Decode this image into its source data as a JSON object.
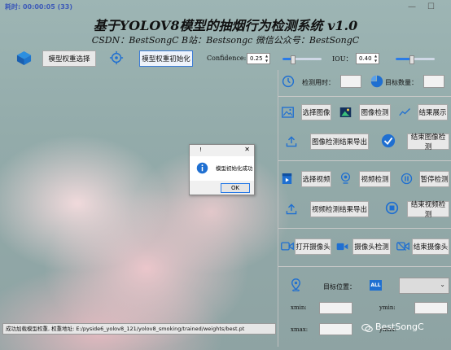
{
  "window": {
    "timer_label": "耗时: 00:00:05 (33)"
  },
  "header": {
    "title": "基于YOLOV8模型的抽烟行为检测系统 v1.0",
    "subtitle": "CSDN：BestSongC   B站：Bestsongc   微信公众号：BestSongC"
  },
  "toolbar": {
    "select_model": "模型权重选择",
    "init_model": "模型权重初始化",
    "confidence_label": "Confidence:",
    "confidence_value": "0.25",
    "iou_label": "IOU：",
    "iou_value": "0.40",
    "confidence_level": 0.25,
    "iou_level": 0.4
  },
  "stats": {
    "time_label": "检测用时：",
    "count_label": "目标数量："
  },
  "image": {
    "select": "选择图像",
    "detect": "图像检测",
    "show": "结果展示",
    "export": "图像检测结果导出",
    "end": "结束图像检测"
  },
  "video": {
    "select": "选择视频",
    "detect": "视频检测",
    "pause": "暂停检测",
    "export": "视频检测结果导出",
    "end": "结束视频检测"
  },
  "camera": {
    "open": "打开摄像头",
    "detect": "摄像头检测",
    "end": "结束摄像头"
  },
  "target": {
    "pos_label": "目标位置：",
    "all_badge": "ALL",
    "xmin": "xmin:",
    "ymin": "ymin:",
    "xmax": "xmax:",
    "ymax": "ymax:"
  },
  "status": {
    "message": "成功加载模型权重, 权重地址: E:/pyside6_yolov8_121/yolov8_smoking/trained/weights/best.pt"
  },
  "dialog": {
    "title": "!",
    "close": "✕",
    "message": "模型初始化成功",
    "ok": "OK"
  },
  "watermark": "BestSongC",
  "colors": {
    "accent": "#2a7be6",
    "icon_blue": "#1f6fd1"
  }
}
